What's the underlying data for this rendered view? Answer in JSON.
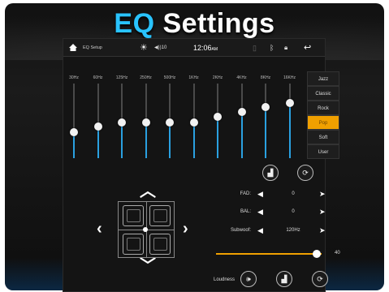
{
  "banner": {
    "prefix": "EQ",
    "rest": " Settings"
  },
  "statusbar": {
    "title": "EQ Setup",
    "volume": "◀))10",
    "time": "12:06",
    "ampm": "AM"
  },
  "eq": {
    "bands": [
      {
        "label": "30Hz",
        "level": 0.35
      },
      {
        "label": "60Hz",
        "level": 0.42
      },
      {
        "label": "125Hz",
        "level": 0.48
      },
      {
        "label": "250Hz",
        "level": 0.48
      },
      {
        "label": "500Hz",
        "level": 0.48
      },
      {
        "label": "1KHz",
        "level": 0.48
      },
      {
        "label": "2KHz",
        "level": 0.55
      },
      {
        "label": "4KHz",
        "level": 0.62
      },
      {
        "label": "8KHz",
        "level": 0.68
      },
      {
        "label": "16KHz",
        "level": 0.74
      }
    ]
  },
  "presets": [
    {
      "label": "Jazz",
      "active": false
    },
    {
      "label": "Classic",
      "active": false
    },
    {
      "label": "Rock",
      "active": false
    },
    {
      "label": "Pop",
      "active": true
    },
    {
      "label": "Soft",
      "active": false
    },
    {
      "label": "User",
      "active": false
    }
  ],
  "params": {
    "fad": {
      "label": "FAD:",
      "value": "0"
    },
    "bal": {
      "label": "BAL:",
      "value": "0"
    },
    "subwoofer": {
      "label": "Subwoof:",
      "value": "120Hz"
    }
  },
  "volume": {
    "value": "40",
    "level": 0.95
  },
  "loudness": {
    "label": "Loudness"
  },
  "colors": {
    "accent": "#f0a000",
    "bar": "#2aa0e0",
    "title": "#29c3ff"
  },
  "icons": {
    "home": "home-icon",
    "sun": "brightness-icon",
    "bluetooth": "bluetooth-icon",
    "lock": "lock-icon",
    "back": "back-icon"
  }
}
